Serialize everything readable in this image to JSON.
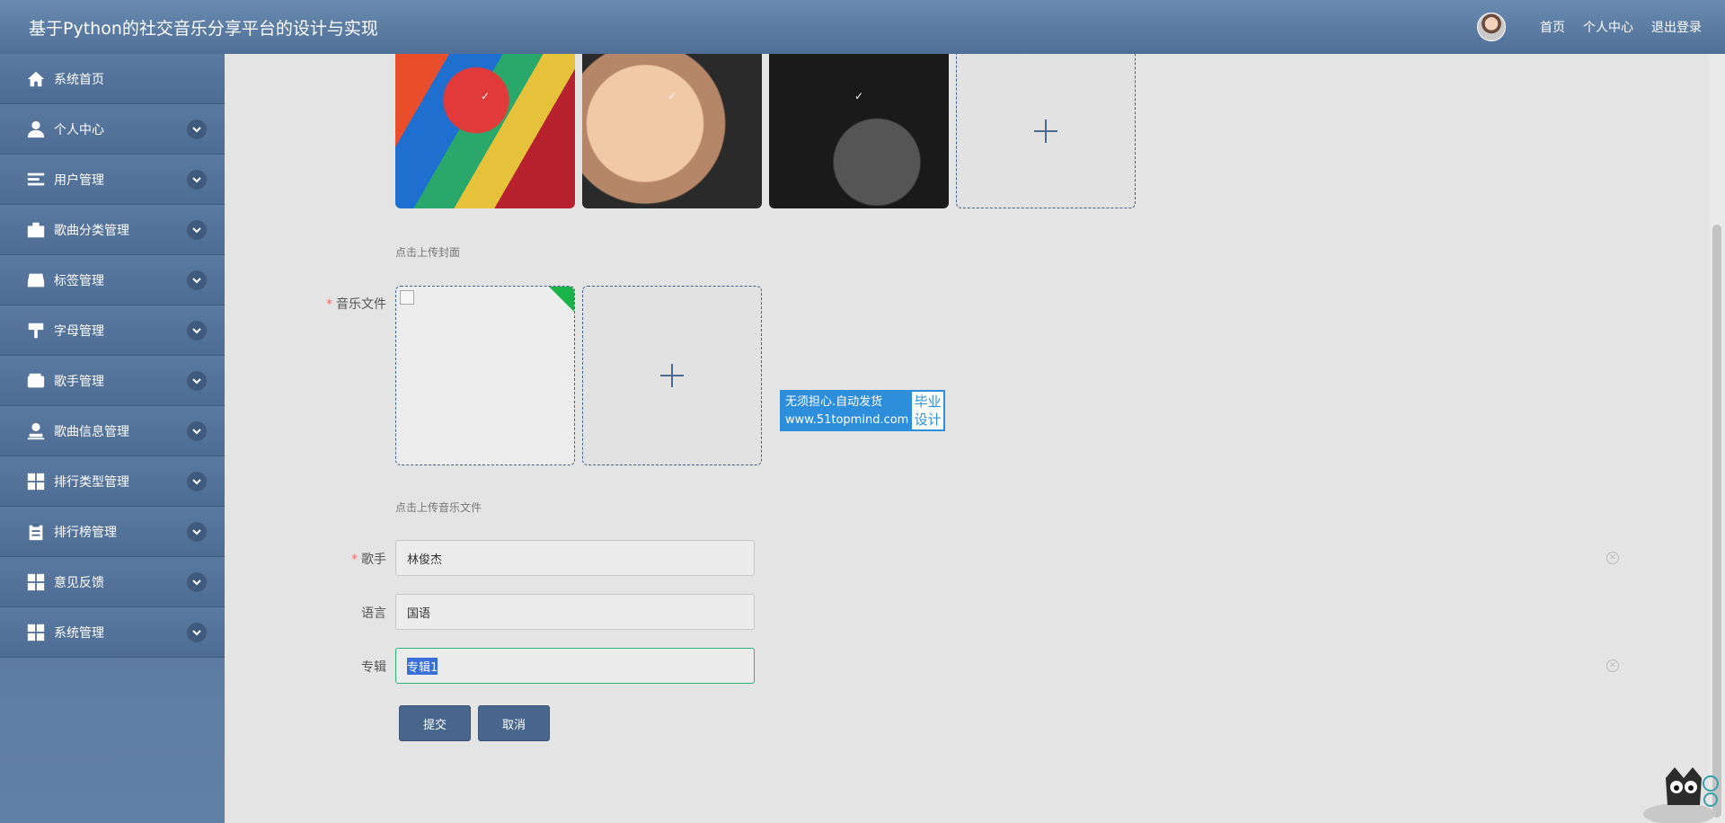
{
  "header": {
    "title": "基于Python的社交音乐分享平台的设计与实现",
    "links": [
      "首页",
      "个人中心",
      "退出登录"
    ]
  },
  "sidebar": {
    "items": [
      {
        "label": "系统首页",
        "icon": "home-icon"
      },
      {
        "label": "个人中心",
        "icon": "person-icon"
      },
      {
        "label": "用户管理",
        "icon": "list-icon"
      },
      {
        "label": "歌曲分类管理",
        "icon": "briefcase-icon"
      },
      {
        "label": "标签管理",
        "icon": "inbox-icon"
      },
      {
        "label": "字母管理",
        "icon": "brush-icon"
      },
      {
        "label": "歌手管理",
        "icon": "wallet-icon"
      },
      {
        "label": "歌曲信息管理",
        "icon": "stamp-icon"
      },
      {
        "label": "排行类型管理",
        "icon": "grid-icon"
      },
      {
        "label": "排行榜管理",
        "icon": "clipboard-icon"
      },
      {
        "label": "意见反馈",
        "icon": "grid-icon"
      },
      {
        "label": "系统管理",
        "icon": "grid-icon"
      }
    ]
  },
  "form": {
    "cover_hint": "点击上传封面",
    "music_label": "音乐文件",
    "music_hint": "点击上传音乐文件",
    "singer_label": "歌手",
    "singer_value": "林俊杰",
    "language_label": "语言",
    "language_value": "国语",
    "album_label": "专辑",
    "album_value": "专辑1",
    "submit_label": "提交",
    "cancel_label": "取消"
  },
  "watermark": {
    "line1": "无须担心.自动发货",
    "line2": "www.51topmind.com",
    "badge_line1": "毕业",
    "badge_line2": "设计"
  },
  "colors": {
    "header": "#5a7ca3",
    "sidebar": "#506f96",
    "accent": "#48658c",
    "required": "#f56c6c"
  }
}
